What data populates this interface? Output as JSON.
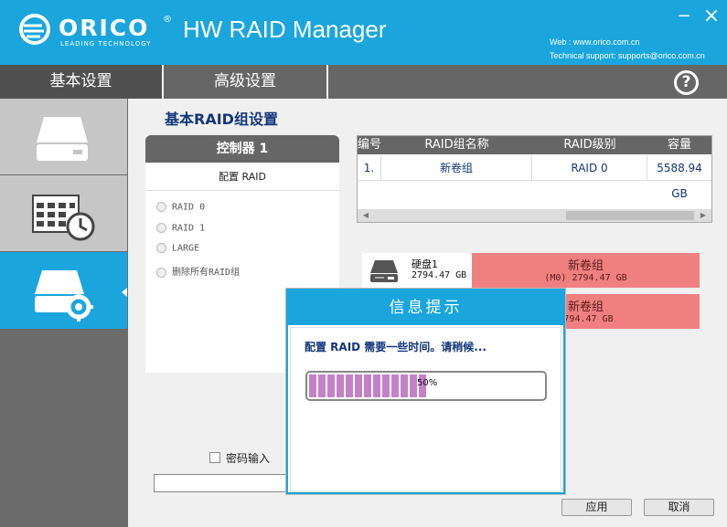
{
  "header": {
    "logo_brand": "ORICO",
    "logo_reg": "®",
    "logo_tagline": "LEADING TECHNOLOGY",
    "app_title": "HW RAID Manager",
    "minimize": "−",
    "close": "×",
    "web": "Web : www.orico.com.cn",
    "support": "Technical support: supports@orico.com.cn"
  },
  "tabs": [
    {
      "label": "基本设置",
      "active": true
    },
    {
      "label": "高级设置",
      "active": false
    }
  ],
  "help_icon": "?",
  "sidebar": {
    "items": [
      {
        "icon": "disk-icon",
        "active": false
      },
      {
        "icon": "schedule-icon",
        "active": false
      },
      {
        "icon": "raid-settings-icon",
        "active": true
      }
    ]
  },
  "main": {
    "title": "基本RAID组设置",
    "controller": {
      "title": "控制器 1",
      "subtitle": "配置 RAID",
      "options": [
        "RAID 0",
        "RAID 1",
        "LARGE",
        "删除所有RAID组"
      ]
    },
    "table": {
      "headers": [
        "编号",
        "RAID组名称",
        "RAID级别",
        "容量"
      ],
      "rows": [
        {
          "no": "1.",
          "name": "新卷组",
          "level": "RAID 0",
          "capacity": "5588.94 GB"
        }
      ]
    },
    "disks": [
      {
        "name": "硬盘1",
        "size": "2794.47 GB",
        "volume": "新卷组",
        "volume_detail": "(M0) 2794.47 GB"
      },
      {
        "name": "",
        "size": "",
        "volume": "新卷组",
        "volume_detail": "2794.47 GB"
      }
    ],
    "password_label": "密码输入",
    "apply_button": "应用",
    "cancel_button": "取消"
  },
  "dialog": {
    "title": "信息提示",
    "message": "配置 RAID 需要一些时间。请稍候...",
    "progress": 50,
    "progress_label": "50%"
  },
  "colors": {
    "accent": "#1aa6dd",
    "tab_bg": "#666666",
    "volume_bar": "#f08080",
    "progress_fill": "#c581c8",
    "title_text": "#13367a"
  }
}
